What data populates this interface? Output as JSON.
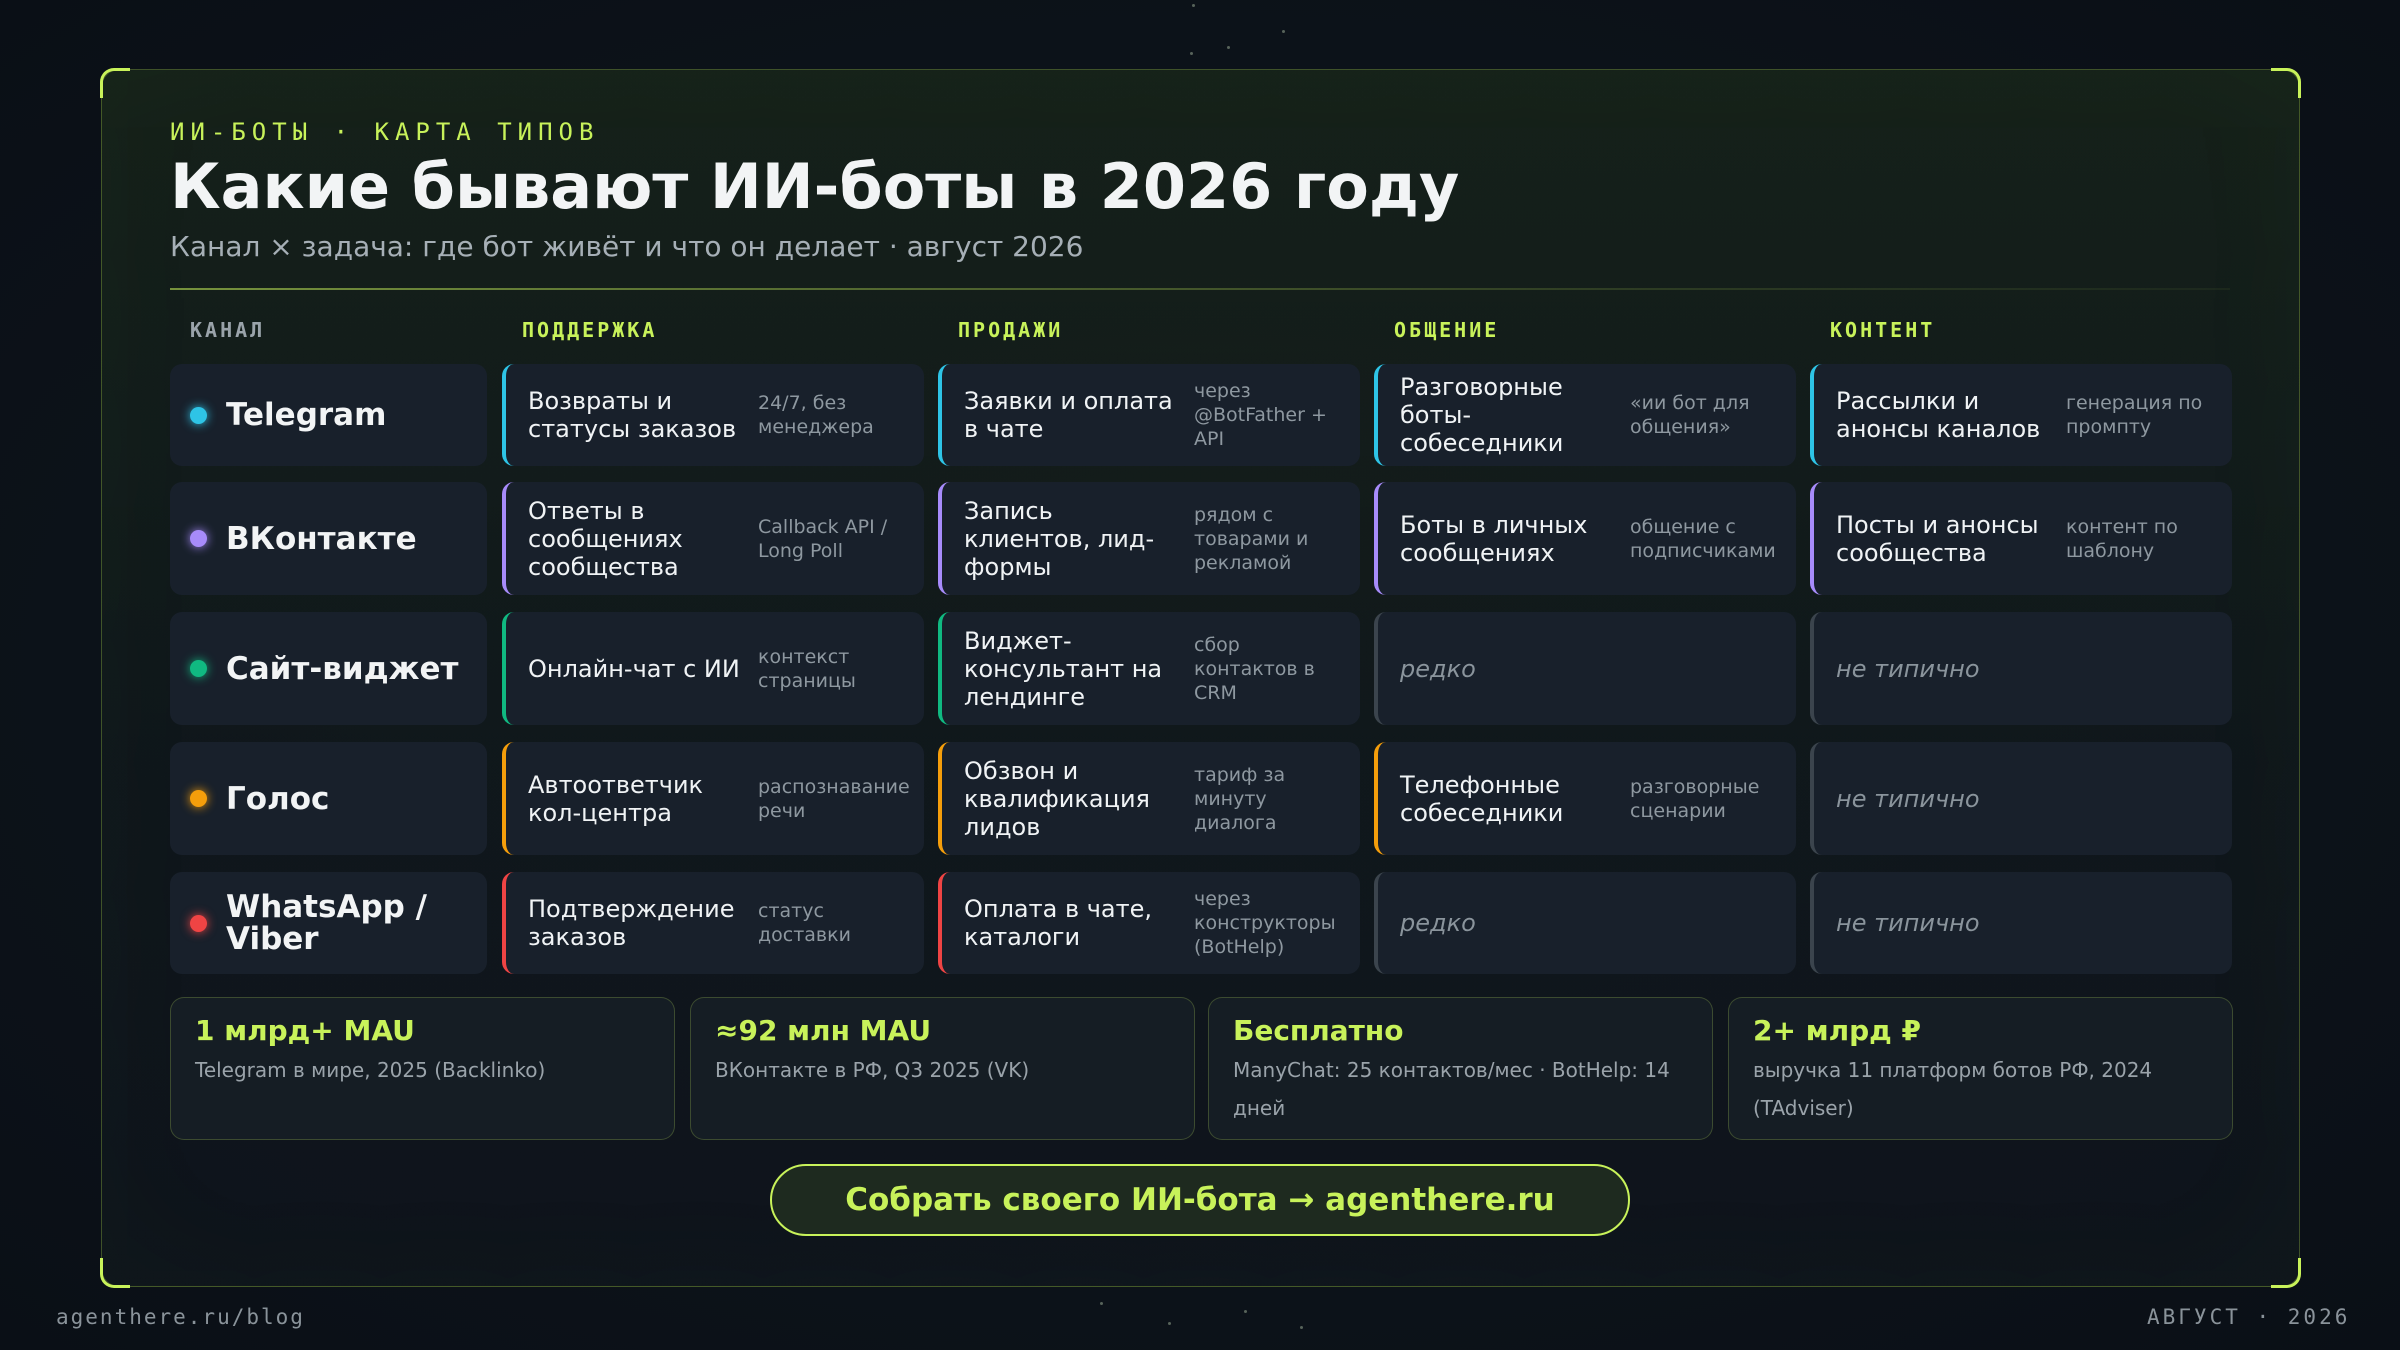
{
  "header": {
    "eyebrow": "ИИ-БОТЫ · КАРТА ТИПОВ",
    "title": "Какие бывают ИИ-боты в 2026 году",
    "subtitle": "Канал × задача: где бот живёт и что он делает · август 2026"
  },
  "columns": {
    "channel": "КАНАЛ",
    "support": "ПОДДЕРЖКА",
    "sales": "ПРОДАЖИ",
    "chat": "ОБЩЕНИЕ",
    "content": "КОНТЕНТ"
  },
  "colors": {
    "accent": "#c8f25a",
    "telegram": "#2ec4e6",
    "vk": "#a78bfa",
    "widget": "#10b981",
    "voice": "#f59e0b",
    "whatsapp": "#ef4444",
    "muted": "#3b444d"
  },
  "rows": [
    {
      "channel": "Telegram",
      "support": {
        "main": "Возвраты и статусы заказов",
        "note": "24/7, без менеджера"
      },
      "sales": {
        "main": "Заявки и оплата в чате",
        "note": "через @BotFather + API"
      },
      "chat": {
        "main": "Разговорные боты-собеседники",
        "note": "«ии бот для общения»"
      },
      "content": {
        "main": "Рассылки и анонсы каналов",
        "note": "генерация по промпту"
      }
    },
    {
      "channel": "ВКонтакте",
      "support": {
        "main": "Ответы в сообщениях сообщества",
        "note": "Callback API / Long Poll"
      },
      "sales": {
        "main": "Запись клиентов, лид-формы",
        "note": "рядом с товарами и рекламой"
      },
      "chat": {
        "main": "Боты в личных сообщениях",
        "note": "общение с подписчиками"
      },
      "content": {
        "main": "Посты и анонсы сообщества",
        "note": "контент по шаблону"
      }
    },
    {
      "channel": "Сайт-виджет",
      "support": {
        "main": "Онлайн-чат с ИИ",
        "note": "контекст страницы"
      },
      "sales": {
        "main": "Виджет-консультант на лендинге",
        "note": "сбор контактов в CRM"
      },
      "chat": {
        "main": "редко",
        "note": ""
      },
      "content": {
        "main": "не типично",
        "note": ""
      }
    },
    {
      "channel": "Голос",
      "support": {
        "main": "Автоответчик кол-центра",
        "note": "распознавание речи"
      },
      "sales": {
        "main": "Обзвон и квалификация лидов",
        "note": "тариф за минуту диалога"
      },
      "chat": {
        "main": "Телефонные собеседники",
        "note": "разговорные сценарии"
      },
      "content": {
        "main": "не типично",
        "note": ""
      }
    },
    {
      "channel": "WhatsApp / Viber",
      "support": {
        "main": "Подтверждение заказов",
        "note": "статус доставки"
      },
      "sales": {
        "main": "Оплата в чате, каталоги",
        "note": "через конструкторы (BotHelp)"
      },
      "chat": {
        "main": "редко",
        "note": ""
      },
      "content": {
        "main": "не типично",
        "note": ""
      }
    }
  ],
  "stats": [
    {
      "big": "1 млрд+ MAU",
      "small": "Telegram в мире, 2025 (Backlinko)"
    },
    {
      "big": "≈92 млн MAU",
      "small": "ВКонтакте в РФ, Q3 2025 (VK)"
    },
    {
      "big": "Бесплатно",
      "small": "ManyChat: 25 контактов/мес · BotHelp: 14 дней"
    },
    {
      "big": "2+ млрд ₽",
      "small": "выручка 11 платформ ботов РФ, 2024 (TAdviser)"
    }
  ],
  "cta": "Собрать своего ИИ-бота → agenthere.ru",
  "footer": {
    "left": "agenthere.ru/blog",
    "right": "АВГУСТ · 2026"
  }
}
